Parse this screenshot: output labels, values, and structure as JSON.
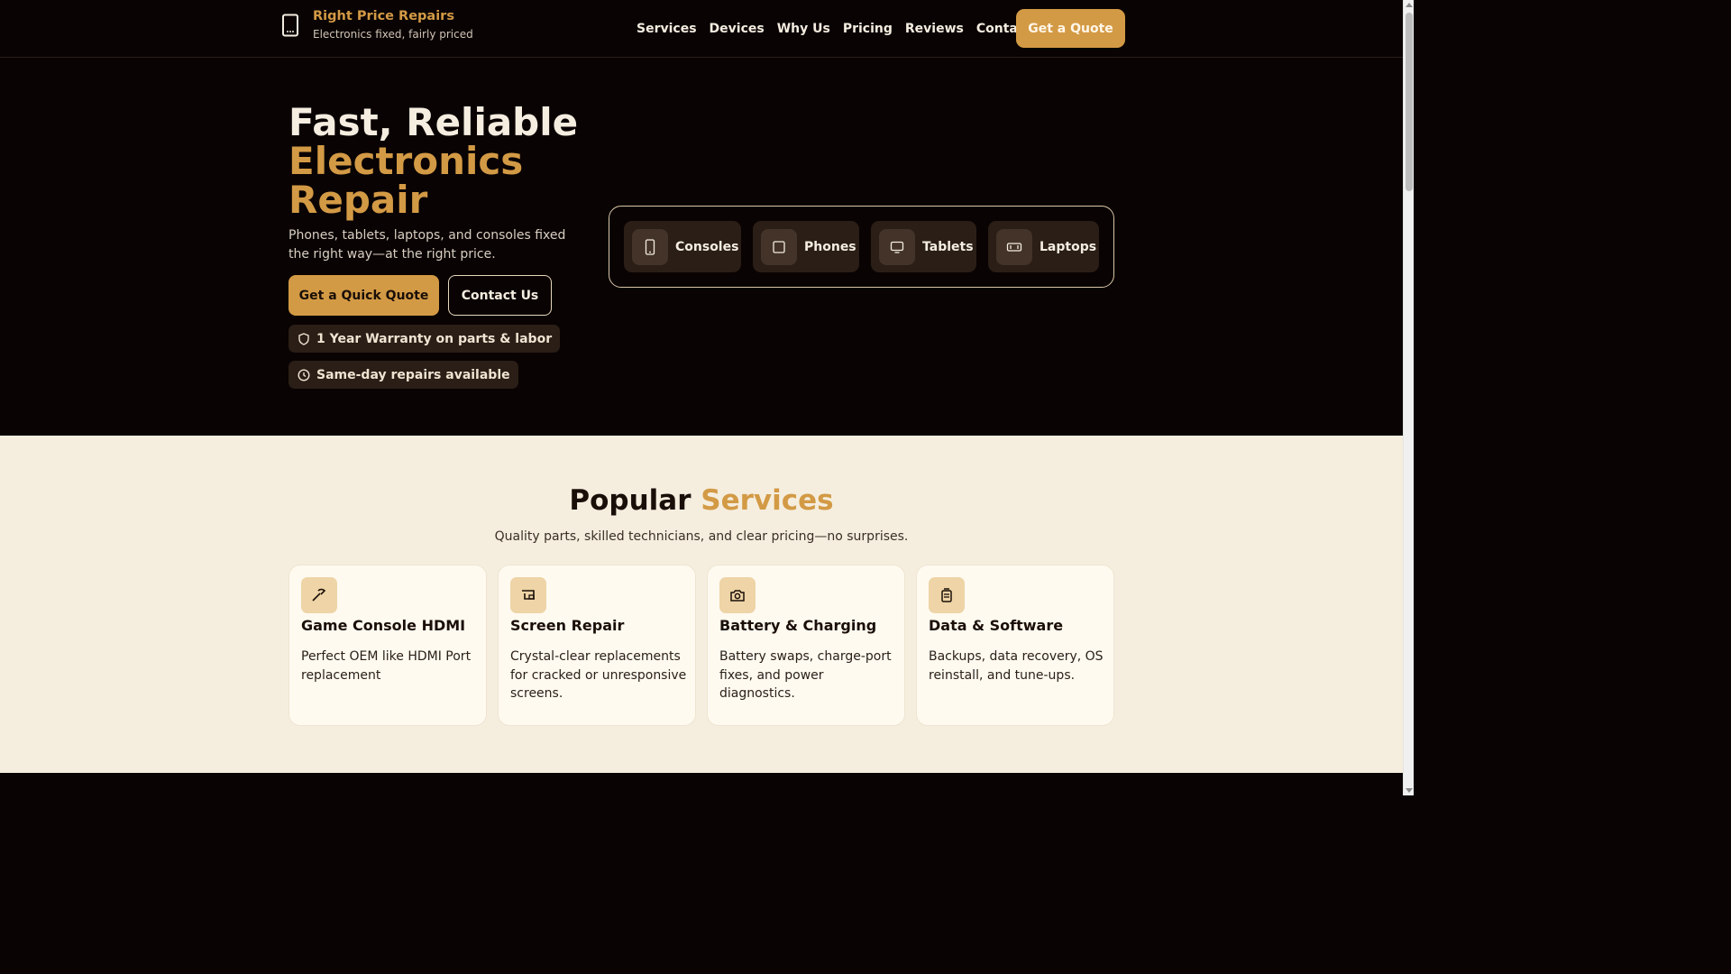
{
  "brand": {
    "name": "Right Price Repairs",
    "tagline": "Electronics fixed, fairly priced"
  },
  "nav": {
    "items": [
      "Services",
      "Devices",
      "Why Us",
      "Pricing",
      "Reviews",
      "Contact"
    ],
    "cta": "Get a Quote"
  },
  "hero": {
    "title_line1": "Fast, Reliable",
    "title_line2": "Electronics",
    "title_line3": "Repair",
    "subtitle": "Phones, tablets, laptops, and consoles fixed the right way—at the right price.",
    "primary_button": "Get a Quick Quote",
    "secondary_button": "Contact Us",
    "badges": [
      "1 Year Warranty on parts & labor",
      "Same-day repairs available"
    ]
  },
  "devices": [
    {
      "label": "Consoles",
      "icon": "phone-outline-icon"
    },
    {
      "label": "Phones",
      "icon": "square-icon"
    },
    {
      "label": "Tablets",
      "icon": "monitor-icon"
    },
    {
      "label": "Laptops",
      "icon": "laptop-icon"
    }
  ],
  "services": {
    "title_main": "Popular",
    "title_accent": "Services",
    "subtitle": "Quality parts, skilled technicians, and clear pricing—no surprises.",
    "cards": [
      {
        "title": "Game Console HDMI",
        "description": "Perfect OEM like HDMI Port replacement",
        "icon": "hammer-icon"
      },
      {
        "title": "Screen Repair",
        "description": "Crystal-clear replacements for cracked or unresponsive screens.",
        "icon": "screen-icon"
      },
      {
        "title": "Battery & Charging",
        "description": "Battery swaps, charge-port fixes, and power diagnostics.",
        "icon": "camera-icon"
      },
      {
        "title": "Data & Software",
        "description": "Backups, data recovery, OS reinstall, and tune-ups.",
        "icon": "database-icon"
      }
    ]
  },
  "colors": {
    "accent": "#d39a45",
    "dark_bg": "#0a0303",
    "light_bg": "#f5eedf"
  }
}
